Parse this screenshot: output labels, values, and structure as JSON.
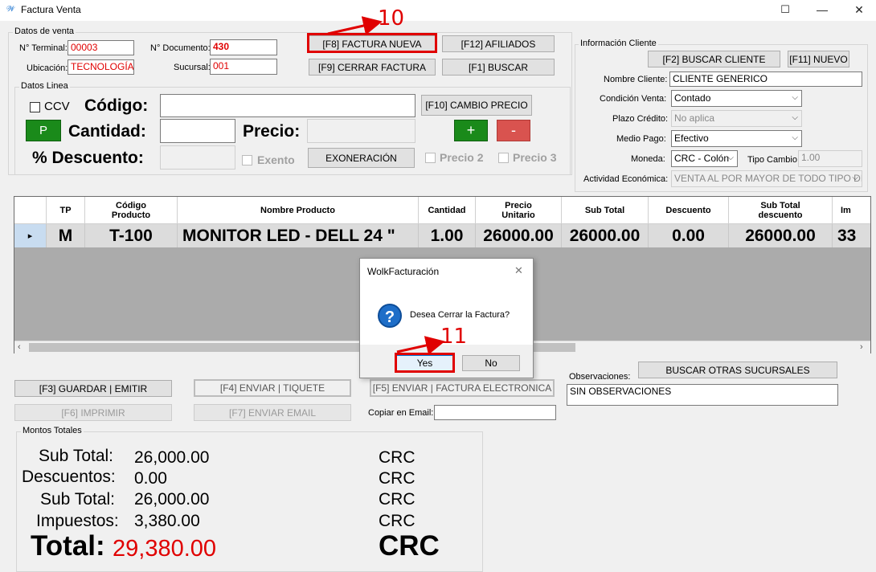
{
  "window": {
    "title": "Factura Venta",
    "minimize": "—",
    "maximize": "☐",
    "close": "✕"
  },
  "sales": {
    "legend": "Datos de venta",
    "terminal_label": "N° Terminal:",
    "terminal_value": "00003",
    "documento_label": "N° Documento:",
    "documento_value": "430",
    "ubicacion_label": "Ubicación:",
    "ubicacion_value": "TECNOLOGÍA",
    "sucursal_label": "Sucursal:",
    "sucursal_value": "001"
  },
  "top_buttons": {
    "factura_nueva": "[F8] FACTURA NUEVA",
    "afiliados": "[F12] AFILIADOS",
    "cerrar_factura": "[F9] CERRAR FACTURA",
    "buscar": "[F1] BUSCAR"
  },
  "line": {
    "legend": "Datos Linea",
    "ccv_label": "CCV",
    "codigo_label": "Código:",
    "cantidad_label": "Cantidad:",
    "precio_label": "Precio:",
    "descuento_label": "% Descuento:",
    "exento_label": "Exento",
    "p_button": "P",
    "cambio_precio": "[F10] CAMBIO PRECIO",
    "plus_button": "+",
    "minus_button": "-",
    "exoneracion": "EXONERACIÓN",
    "precio2": "Precio 2",
    "precio3": "Precio 3"
  },
  "client": {
    "legend": "Información Cliente",
    "buscar_cliente": "[F2] BUSCAR CLIENTE",
    "nuevo": "[F11] NUEVO",
    "nombre_label": "Nombre Cliente:",
    "nombre_value": "CLIENTE GENERICO",
    "condicion_label": "Condición Venta:",
    "condicion_value": "Contado",
    "plazo_label": "Plazo Crédito:",
    "plazo_value": "No aplica",
    "medio_label": "Medio Pago:",
    "medio_value": "Efectivo",
    "moneda_label": "Moneda:",
    "moneda_value": "CRC - Colón",
    "tipo_cambio_label": "Tipo Cambio:",
    "tipo_cambio_value": "1.00",
    "actividad_label": "Actividad Económica:",
    "actividad_value": "VENTA AL POR MAYOR DE TODO TIPO DE"
  },
  "grid": {
    "headers": [
      "",
      "TP",
      "Código\nProducto",
      "Nombre Producto",
      "Cantidad",
      "Precio\nUnitario",
      "Sub Total",
      "Descuento",
      "Sub Total\ndescuento",
      "Im"
    ],
    "rows": [
      {
        "marker": "▸",
        "tp": "M",
        "codigo": "T-100",
        "nombre": "MONITOR LED - DELL  24 \"",
        "cantidad": "1.00",
        "precio": "26000.00",
        "subtotal": "26000.00",
        "descuento": "0.00",
        "subtotal_desc": "26000.00",
        "imp": "33"
      }
    ]
  },
  "dialog": {
    "title": "WolkFacturación",
    "close": "✕",
    "icon": "question-icon",
    "icon_glyph": "?",
    "message": "Desea Cerrar la Factura?",
    "yes": "Yes",
    "no": "No"
  },
  "bottom_buttons": {
    "guardar": "[F3] GUARDAR | EMITIR",
    "enviar_tiquete": "[F4] ENVIAR | TIQUETE",
    "enviar_factura": "[F5] ENVIAR | FACTURA ELECTRONICA",
    "imprimir": "[F6] IMPRIMIR",
    "enviar_email": "[F7] ENVIAR EMAIL",
    "copiar_email_label": "Copiar en Email:",
    "copiar_email_value": "",
    "observaciones_label": "Observaciones:",
    "observaciones_value": "SIN OBSERVACIONES",
    "buscar_sucursales": "BUSCAR OTRAS SUCURSALES"
  },
  "totals": {
    "legend": "Montos Totales",
    "subtotal_label": "Sub Total:",
    "subtotal_value": "26,000.00",
    "descuentos_label": "Descuentos:",
    "descuentos_value": "0.00",
    "subtotal2_label": "Sub Total:",
    "subtotal2_value": "26,000.00",
    "impuestos_label": "Impuestos:",
    "impuestos_value": "3,380.00",
    "total_label": "Total:",
    "total_value": "29,380.00",
    "currency": "CRC"
  },
  "annotations": {
    "step10": "10",
    "step11": "11"
  },
  "colors": {
    "annotation": "#e00000",
    "green_button": "#1a8a1a",
    "red_button": "#d9534f",
    "total_value": "#e00000"
  }
}
